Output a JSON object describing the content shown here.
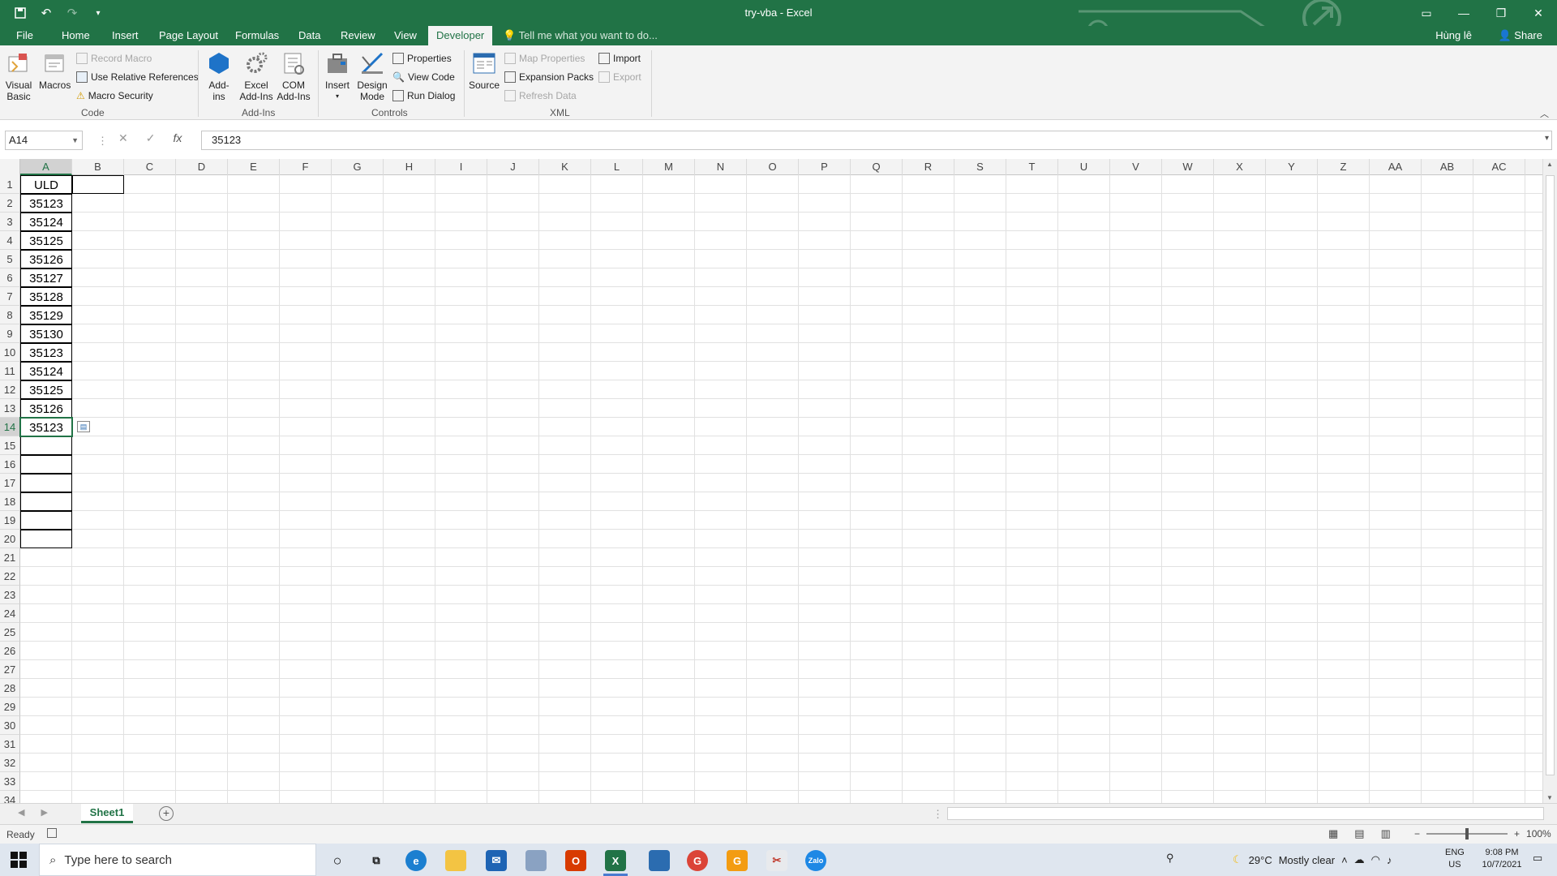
{
  "app": {
    "title": "try-vba - Excel",
    "user": "Hùng lê",
    "share": "Share",
    "accent": "#217346"
  },
  "tabs": [
    "File",
    "Home",
    "Insert",
    "Page Layout",
    "Formulas",
    "Data",
    "Review",
    "View",
    "Developer"
  ],
  "active_tab": "Developer",
  "tell_me": "Tell me what you want to do...",
  "ribbon": {
    "code": {
      "label": "Code",
      "visual_basic": "Visual Basic",
      "macros": "Macros",
      "record_macro": "Record Macro",
      "use_relative": "Use Relative References",
      "macro_security": "Macro Security"
    },
    "addins": {
      "label": "Add-Ins",
      "addins": "Add-ins",
      "excel_addins": "Excel Add-Ins",
      "com_addins": "COM Add-Ins"
    },
    "controls": {
      "label": "Controls",
      "insert": "Insert",
      "design_mode": "Design Mode",
      "properties": "Properties",
      "view_code": "View Code",
      "run_dialog": "Run Dialog"
    },
    "xml": {
      "label": "XML",
      "source": "Source",
      "map_properties": "Map Properties",
      "expansion_packs": "Expansion Packs",
      "refresh_data": "Refresh Data",
      "import": "Import",
      "export": "Export"
    }
  },
  "formula_bar": {
    "name_box": "A14",
    "value": "35123"
  },
  "columns": [
    "A",
    "B",
    "C",
    "D",
    "E",
    "F",
    "G",
    "H",
    "I",
    "J",
    "K",
    "L",
    "M",
    "N",
    "O",
    "P",
    "Q",
    "R",
    "S",
    "T",
    "U",
    "V",
    "W",
    "X",
    "Y",
    "Z",
    "AA",
    "AB",
    "AC"
  ],
  "rows": [
    "1",
    "2",
    "3",
    "4",
    "5",
    "6",
    "7",
    "8",
    "9",
    "10",
    "11",
    "12",
    "13",
    "14",
    "15",
    "16",
    "17",
    "18",
    "19",
    "20",
    "21",
    "22",
    "23",
    "24",
    "25",
    "26",
    "27",
    "28",
    "29",
    "30",
    "31",
    "32",
    "33",
    "34"
  ],
  "column_a": [
    "ULD",
    "35123",
    "35124",
    "35125",
    "35126",
    "35127",
    "35128",
    "35129",
    "35130",
    "35123",
    "35124",
    "35125",
    "35126",
    "35123"
  ],
  "sheet": {
    "name": "Sheet1"
  },
  "status": {
    "ready": "Ready",
    "zoom": "100%"
  },
  "taskbar": {
    "search_placeholder": "Type here to search",
    "temperature": "29°C",
    "weather": "Mostly clear",
    "lang": "ENG",
    "region": "US",
    "time": "9:08 PM",
    "date": "10/7/2021"
  }
}
